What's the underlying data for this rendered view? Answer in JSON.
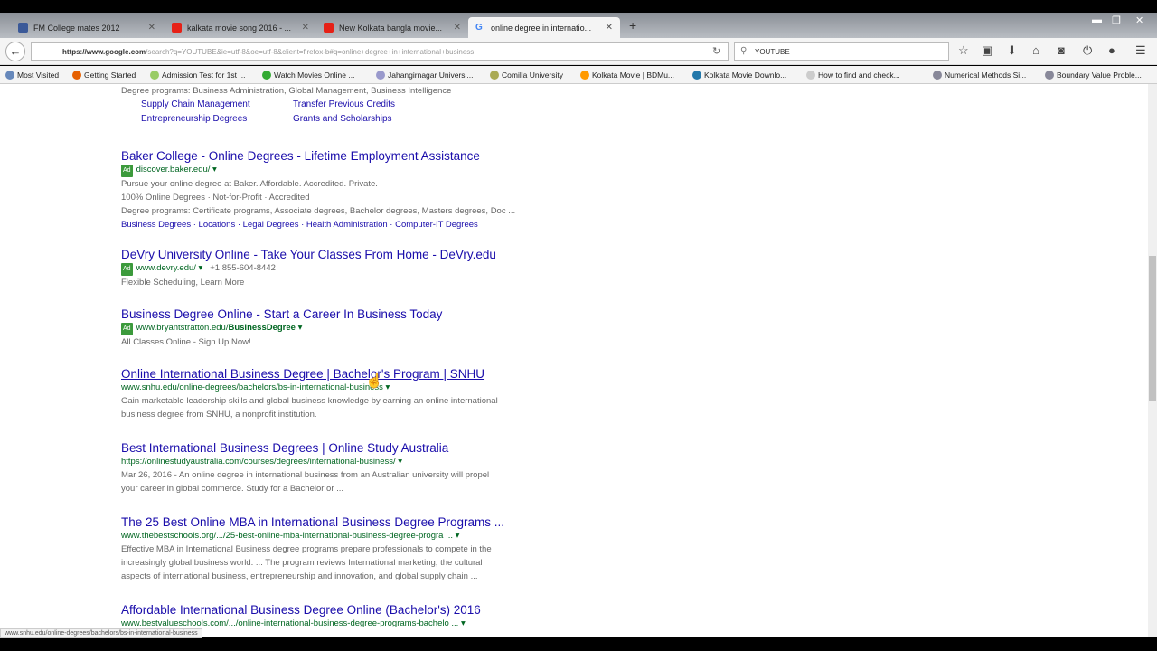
{
  "tabs": [
    {
      "label": "FM College mates 2012",
      "color": "#3b5998"
    },
    {
      "label": "kalkata movie song 2016 - ...",
      "color": "#e62117"
    },
    {
      "label": "New Kolkata bangla movie...",
      "color": "#e62117"
    },
    {
      "label": "online degree in internatio...",
      "color": "#4285f4"
    }
  ],
  "nav": {
    "url_host": "https://www.google.com",
    "url_rest": "/search?q=YOUTUBE&ie=utf-8&oe=utf-8&client=firefox-b#q=online+degree+in+international+business",
    "search_value": "YOUTUBE"
  },
  "bookmarks": [
    "Most Visited",
    "Getting Started",
    "Admission Test for 1st ...",
    "Watch Movies Online ...",
    "Jahangirnagar Universi...",
    "Comilla University",
    "Kolkata Movie | BDMu...",
    "Kolkata Movie Downlo...",
    "How to find and check...",
    "Numerical Methods Si...",
    "Boundary Value Proble..."
  ],
  "prev": {
    "snippet": "Degree programs: Business Administration, Global Management, Business Intelligence",
    "sitelinks": [
      "Supply Chain Management",
      "Transfer Previous Credits",
      "Entrepreneurship Degrees",
      "Grants and Scholarships"
    ]
  },
  "ad_label": "Ad",
  "results": [
    {
      "title": "Baker College - Online Degrees - Lifetime Employment Assistance",
      "url": "discover.baker.edu/",
      "lines": [
        "Pursue your online degree at Baker. Affordable. Accredited. Private.",
        "100% Online Degrees · Not-for-Profit · Accredited",
        "Degree programs: Certificate programs, Associate degrees, Bachelor degrees, Masters degrees, Doc ..."
      ],
      "links": "Business Degrees · Locations · Legal Degrees · Health Administration · Computer-IT Degrees"
    },
    {
      "title": "DeVry University Online - Take Your Classes From Home - DeVry.edu",
      "url": "www.devry.edu/",
      "phone": "+1 855-604-8442",
      "lines": [
        "Flexible Scheduling, Learn More"
      ]
    },
    {
      "title": "Business Degree Online - Start a Career In Business Today",
      "url": "www.bryantstratton.edu/",
      "url_bold": "BusinessDegree",
      "lines": [
        "All Classes Online - Sign Up Now!"
      ]
    },
    {
      "title": "Online International Business Degree | Bachelor's Program | SNHU",
      "url": "www.snhu.edu/online-degrees/bachelors/bs-in-international-business",
      "lines": [
        "Gain marketable leadership skills and global business knowledge by earning an online international",
        "business degree from SNHU, a nonprofit institution."
      ]
    },
    {
      "title": "Best International Business Degrees | Online Study Australia",
      "url": "https://onlinestudyaustralia.com/courses/degrees/international-business/",
      "lines": [
        "Mar 26, 2016 - An online degree in international business from an Australian university will propel",
        "your career in global commerce. Study for a Bachelor or ..."
      ]
    },
    {
      "title": "The 25 Best Online MBA in International Business Degree Programs ...",
      "url": "www.thebestschools.org/.../25-best-online-mba-international-business-degree-progra ...",
      "lines": [
        "Effective MBA in International Business degree programs prepare professionals to compete in the",
        "increasingly global business world. ... The program reviews International marketing, the cultural",
        "aspects of international business, entrepreneurship and innovation, and global supply chain ..."
      ]
    },
    {
      "title": "Affordable International Business Degree Online (Bachelor's) 2016",
      "url": "www.bestvalueschools.com/.../online-international-business-degree-programs-bachelo ...",
      "lines": []
    }
  ],
  "status_url": "www.snhu.edu/online-degrees/bachelors/bs-in-international-business"
}
